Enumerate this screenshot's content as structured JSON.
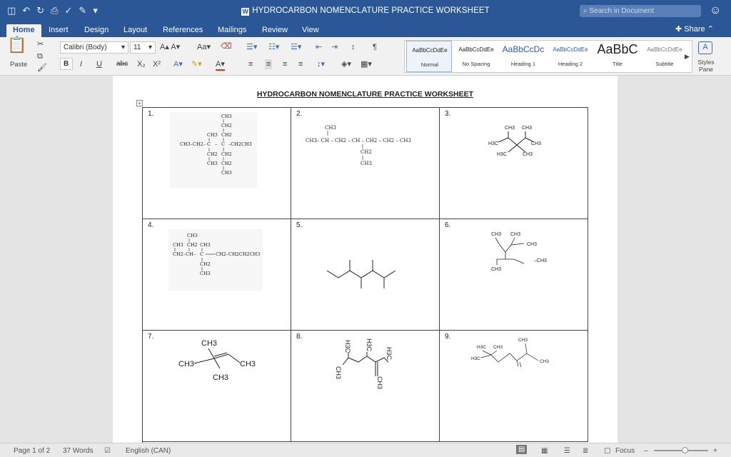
{
  "window": {
    "title": "HYDROCARBON NOMENCLATURE PRACTICE WORKSHEET",
    "search_placeholder": "Search in Document"
  },
  "tabs": [
    "Home",
    "Insert",
    "Design",
    "Layout",
    "References",
    "Mailings",
    "Review",
    "View"
  ],
  "share_label": "Share",
  "ribbon": {
    "paste_label": "Paste",
    "font_name": "Calibri (Body)",
    "font_size": "11",
    "styles": [
      {
        "preview": "AaBbCcDdEe",
        "name": "Normal"
      },
      {
        "preview": "AaBbCcDdEe",
        "name": "No Spacing"
      },
      {
        "preview": "AaBbCcDc",
        "name": "Heading 1"
      },
      {
        "preview": "AaBbCcDdEe",
        "name": "Heading 2"
      },
      {
        "preview": "AaBbC",
        "name": "Title"
      },
      {
        "preview": "AaBbCcDdEe",
        "name": "Subtitle"
      }
    ],
    "styles_pane_label": "Styles Pane"
  },
  "document": {
    "heading": "HYDROCARBON NOMENCLATURE PRACTICE WORKSHEET",
    "cells": [
      {
        "num": "1."
      },
      {
        "num": "2."
      },
      {
        "num": "3."
      },
      {
        "num": "4."
      },
      {
        "num": "5."
      },
      {
        "num": "6."
      },
      {
        "num": "7."
      },
      {
        "num": "8."
      },
      {
        "num": "9."
      }
    ]
  },
  "status": {
    "page": "Page 1 of 2",
    "words": "37 Words",
    "language": "English (CAN)",
    "focus": "Focus"
  },
  "colors": {
    "title_bar": "#2b5796",
    "ribbon": "#f1f1f1"
  }
}
